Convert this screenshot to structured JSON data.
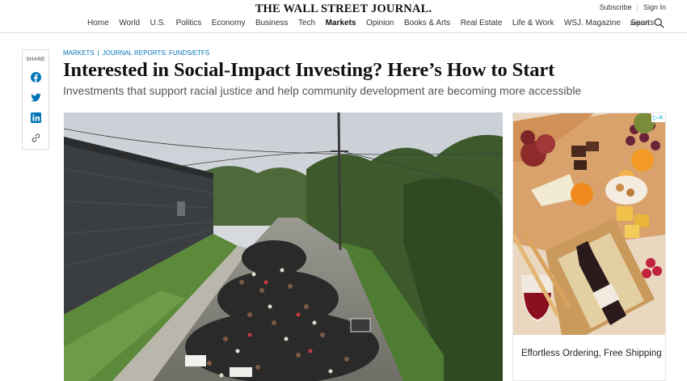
{
  "header": {
    "logo": "THE WALL STREET JOURNAL.",
    "subscribe": "Subscribe",
    "signin": "Sign In",
    "search_label": "Search",
    "nav": [
      {
        "label": "Home",
        "active": false
      },
      {
        "label": "World",
        "active": false
      },
      {
        "label": "U.S.",
        "active": false
      },
      {
        "label": "Politics",
        "active": false
      },
      {
        "label": "Economy",
        "active": false
      },
      {
        "label": "Business",
        "active": false
      },
      {
        "label": "Tech",
        "active": false
      },
      {
        "label": "Markets",
        "active": true
      },
      {
        "label": "Opinion",
        "active": false
      },
      {
        "label": "Books & Arts",
        "active": false
      },
      {
        "label": "Real Estate",
        "active": false
      },
      {
        "label": "Life & Work",
        "active": false
      },
      {
        "label": "WSJ. Magazine",
        "active": false
      },
      {
        "label": "Sports",
        "active": false
      }
    ]
  },
  "share": {
    "label": "SHARE",
    "icons": [
      "facebook-icon",
      "twitter-icon",
      "linkedin-icon",
      "link-icon"
    ]
  },
  "article": {
    "section": "MARKETS",
    "subsection": "JOURNAL REPORTS: FUNDS/ETFS",
    "headline": "Interested in Social-Impact Investing? Here’s How to Start",
    "dek": "Investments that support racial justice and help community development are becoming more accessible"
  },
  "ad": {
    "caption": "Effortless Ordering, Free Shipping",
    "badge": "▷✕"
  },
  "colors": {
    "link_blue": "#0274b6",
    "ad_badge": "#00aecd"
  }
}
